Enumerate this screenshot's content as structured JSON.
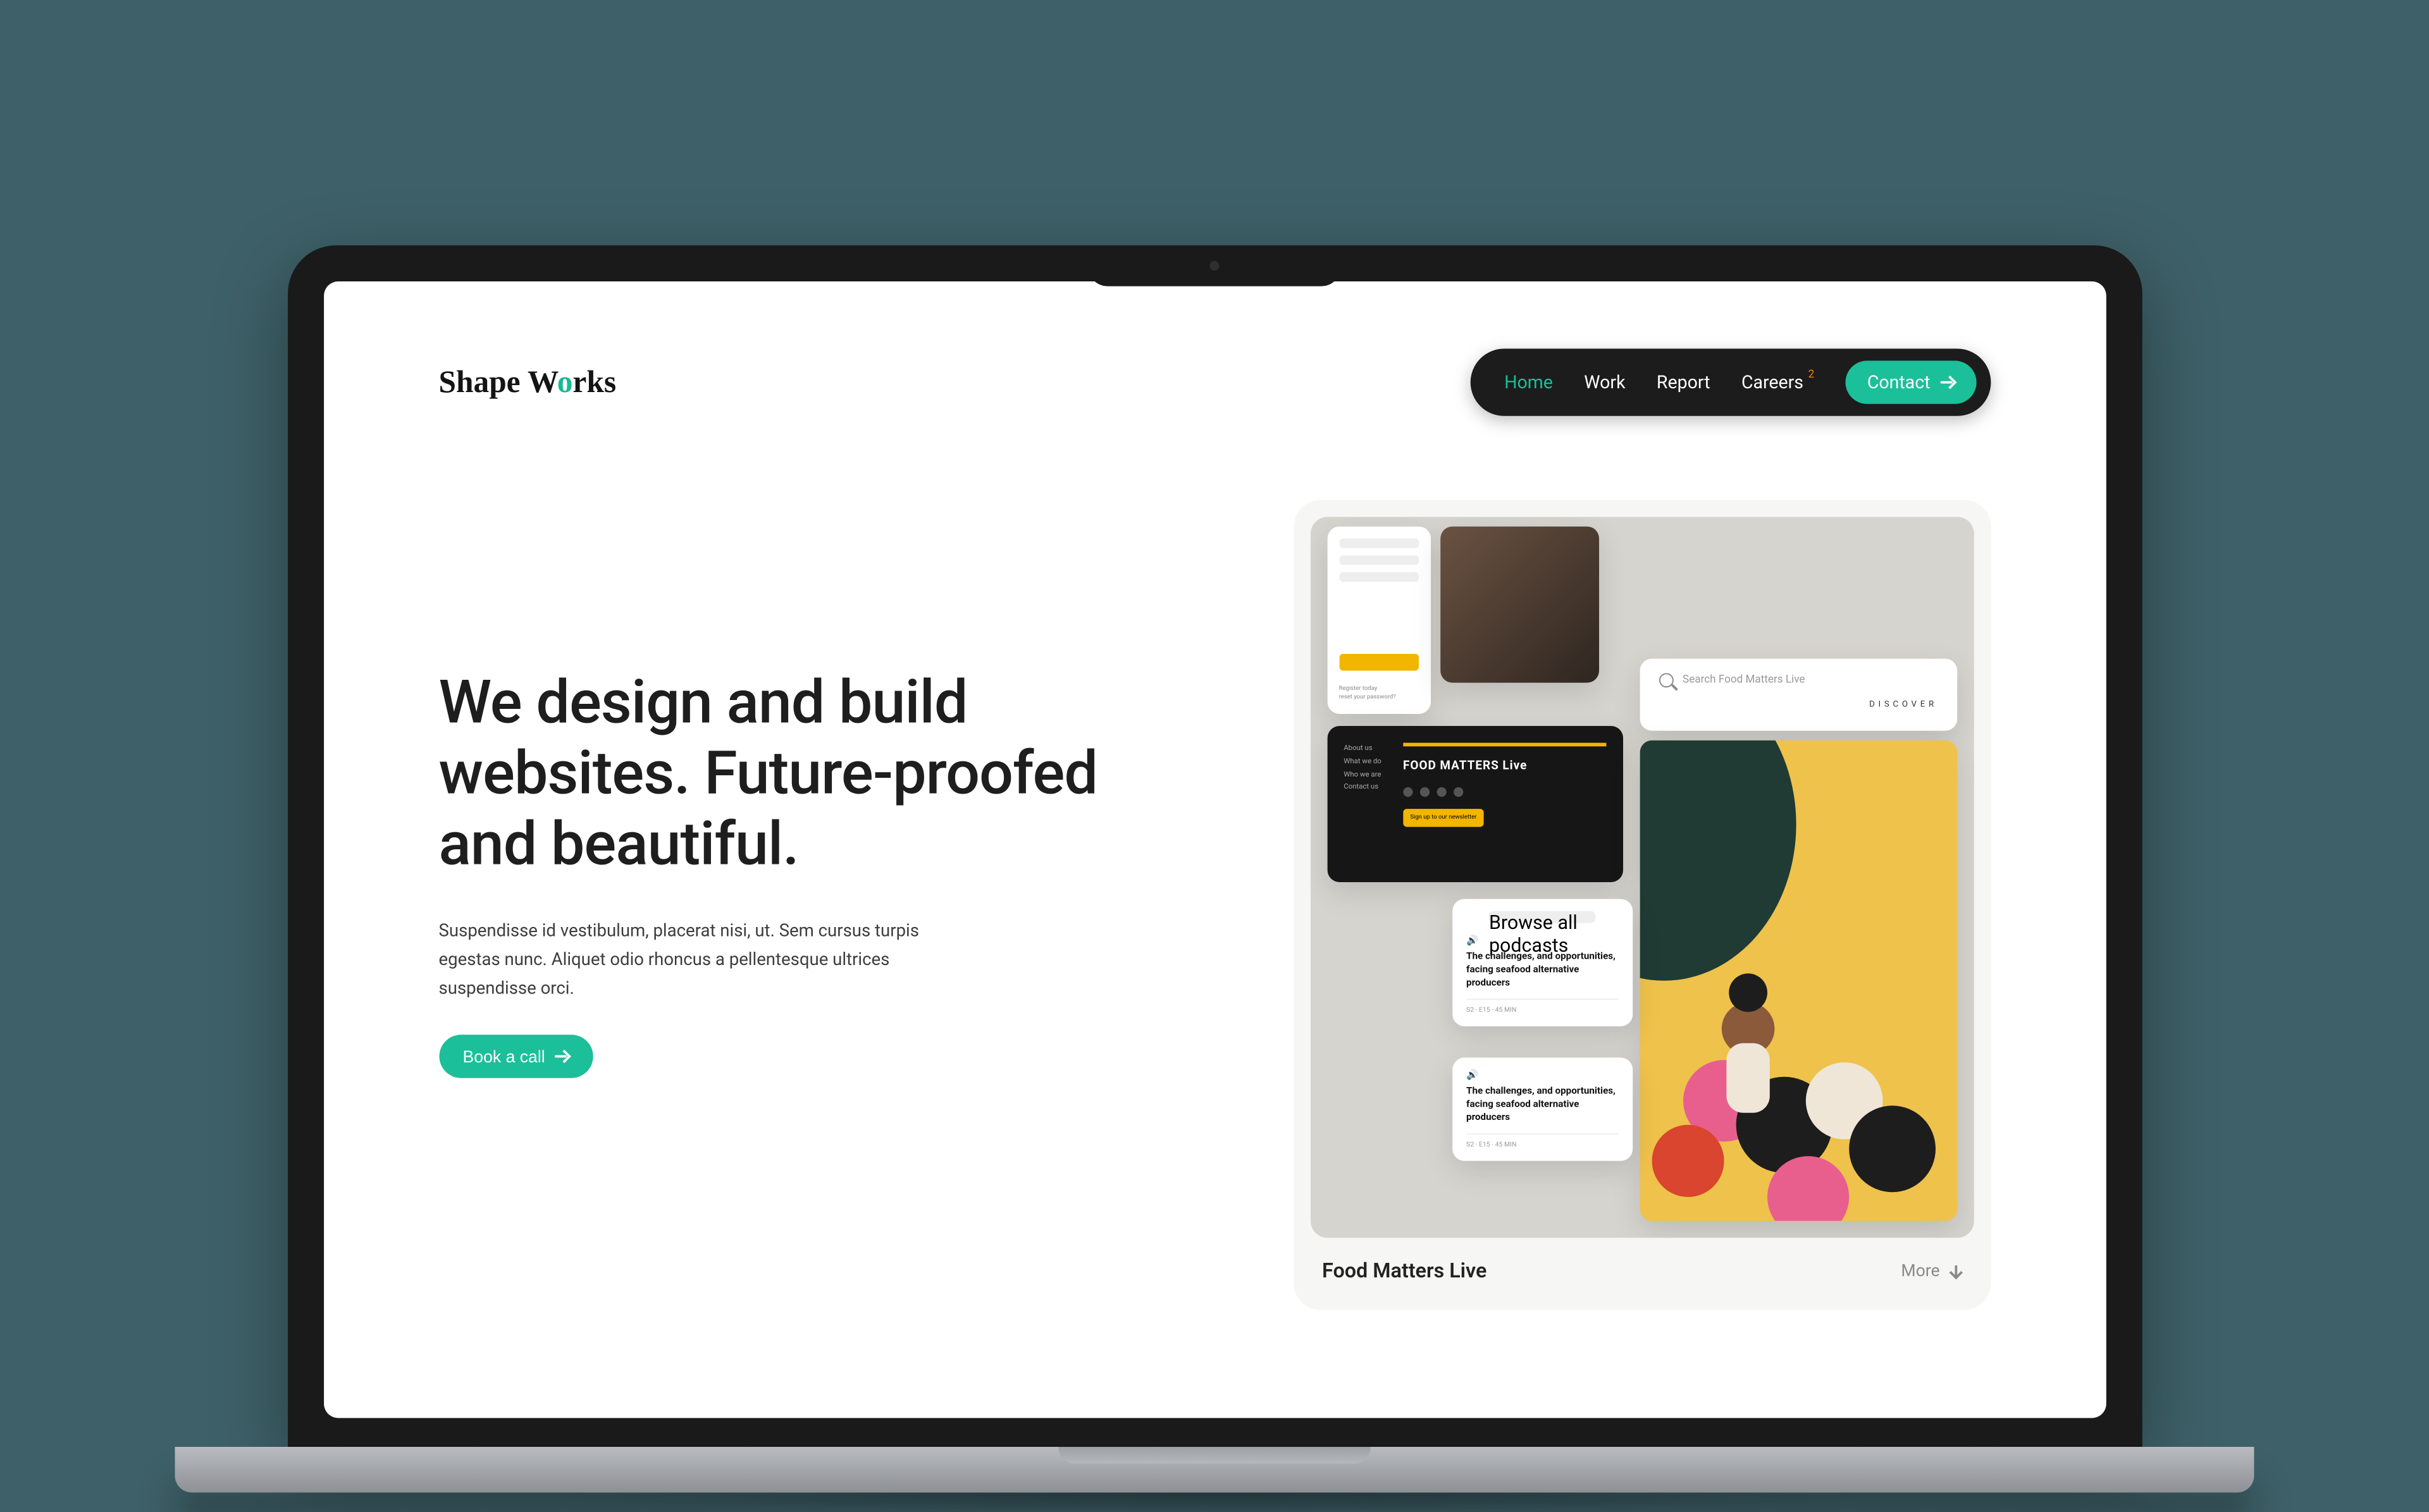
{
  "brand": {
    "pre": "Shape W",
    "accent": "o",
    "post": "rks"
  },
  "nav": {
    "home": "Home",
    "work": "Work",
    "report": "Report",
    "careers": "Careers",
    "careers_badge": "2",
    "contact": "Contact"
  },
  "hero": {
    "headline": "We design and build websites. Future-proofed and beautiful.",
    "sub": "Suspendisse id vestibulum, placerat nisi, ut. Sem cursus turpis egestas nunc. Aliquet odio rhoncus a pellentesque ultrices suspendisse orci.",
    "cta": "Book a call"
  },
  "showcase": {
    "title": "Food Matters Live",
    "more": "More",
    "login": {
      "register": "Register today",
      "reset": "reset your password?"
    },
    "footer_brand": "FOOD MATTERS Live",
    "footer_links": [
      "About us",
      "What we do",
      "Who we are",
      "Contact us"
    ],
    "newsletter": "Sign up to our newsletter",
    "search_placeholder": "Search Food Matters Live",
    "search_cta": "DISCOVER",
    "podcast_header": "Browse all podcasts",
    "podcast_title": "The challenges, and opportunities, facing seafood alternative producers",
    "podcast_meta": "S2 · E15 · 45 MIN"
  }
}
